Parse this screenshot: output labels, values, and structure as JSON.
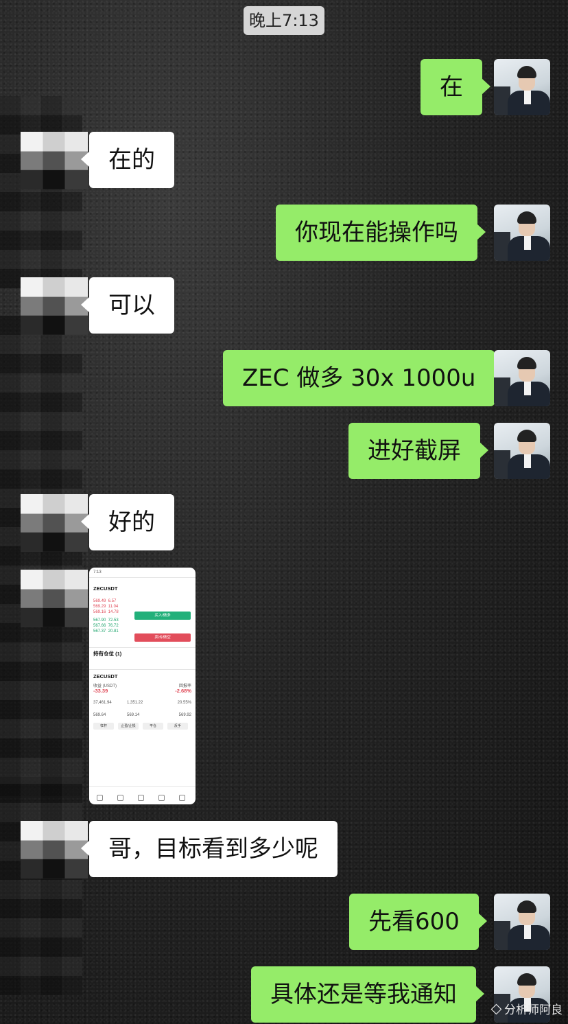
{
  "timestamp": "晚上7:13",
  "messages": [
    {
      "side": "right",
      "text": "在"
    },
    {
      "side": "left",
      "text": "在的"
    },
    {
      "side": "right",
      "text": "你现在能操作吗"
    },
    {
      "side": "left",
      "text": "可以"
    },
    {
      "side": "right",
      "text": "ZEC 做多 30x 1000u"
    },
    {
      "side": "right",
      "text": "进好截屏"
    },
    {
      "side": "left",
      "text": "好的"
    },
    {
      "side": "left",
      "text": "哥，目标看到多少呢"
    },
    {
      "side": "right",
      "text": "先看600"
    },
    {
      "side": "right",
      "text": "具体还是等我通知"
    }
  ],
  "screenshot": {
    "status_time": "7:13",
    "symbol": "ZECUSDT",
    "buy_label": "买入/做多",
    "sell_label": "卖出/做空",
    "positions_tab": "持有仓位 (1)",
    "position_symbol": "ZECUSDT",
    "pnl_label": "收益 (USDT)",
    "pnl_value": "-33.39",
    "roi_label": "回报率",
    "roi_value": "-2.68%",
    "size_value": "37,461.94",
    "margin_value": "1,351.22",
    "ratio_value": "20.55%",
    "entry_value": "569.64",
    "mark_value": "569.14",
    "liq_value": "569.92",
    "action_1": "杠杆",
    "action_2": "止盈/止损",
    "action_3": "平仓",
    "action_4": "反手"
  },
  "watermark": "分析师阿良"
}
